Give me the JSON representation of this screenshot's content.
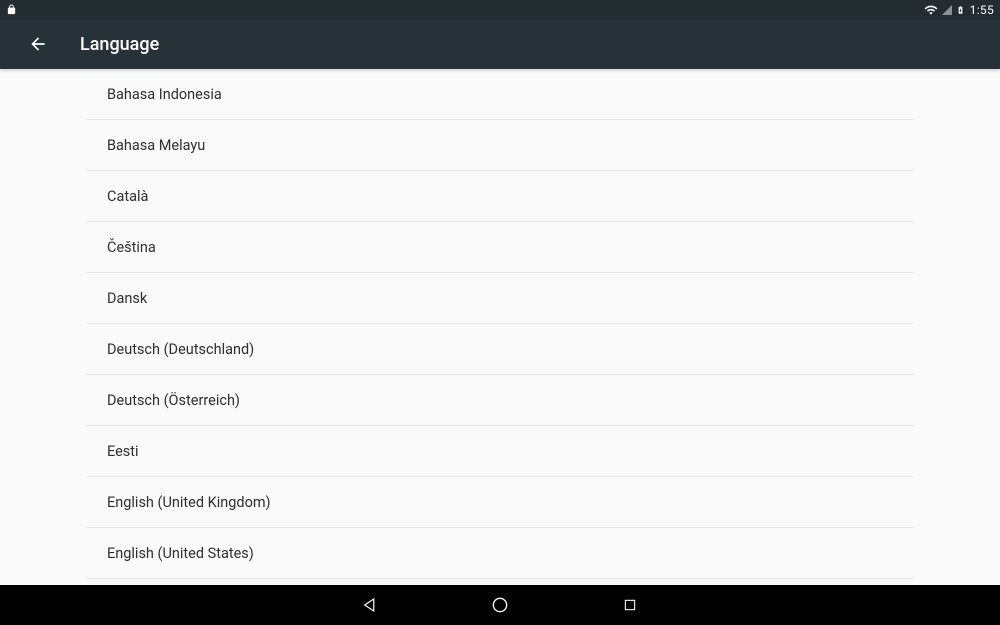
{
  "statusbar": {
    "time": "1:55"
  },
  "header": {
    "title": "Language"
  },
  "languages": [
    "Bahasa Indonesia",
    "Bahasa Melayu",
    "Català",
    "Čeština",
    "Dansk",
    "Deutsch (Deutschland)",
    "Deutsch (Österreich)",
    "Eesti",
    "English (United Kingdom)",
    "English (United States)"
  ]
}
